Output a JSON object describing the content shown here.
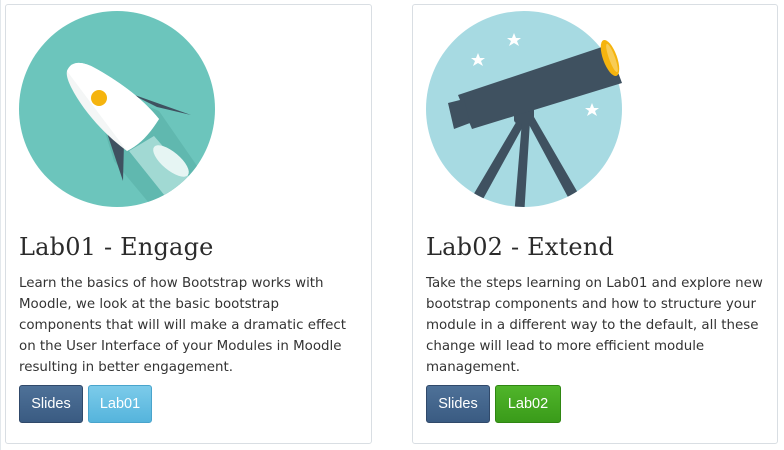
{
  "cards": [
    {
      "title": "Lab01 - Engage",
      "description": "Learn the basics of how Bootstrap works with Moodle, we look at the basic bootstrap components that will will make a dramatic effect on the User Interface of your Modules in Moodle resulting in better engagement.",
      "image_icon": "rocket-icon",
      "buttons": [
        {
          "label": "Slides",
          "color": "#446690"
        },
        {
          "label": "Lab01",
          "color": "#66bfe3"
        }
      ]
    },
    {
      "title": "Lab02 - Extend",
      "description": "Take the steps learning on Lab01 and explore new bootstrap components and how to structure your module in a different way to the default, all these change will lead to more efficient module management.",
      "image_icon": "telescope-icon",
      "buttons": [
        {
          "label": "Slides",
          "color": "#446690"
        },
        {
          "label": "Lab02",
          "color": "#46a622"
        }
      ]
    }
  ],
  "colors": {
    "rocket_bg": "#6cc5bc",
    "telescope_bg": "#a7dae2",
    "telescope_body": "#3f5160",
    "accent_yellow": "#f5b40e"
  }
}
